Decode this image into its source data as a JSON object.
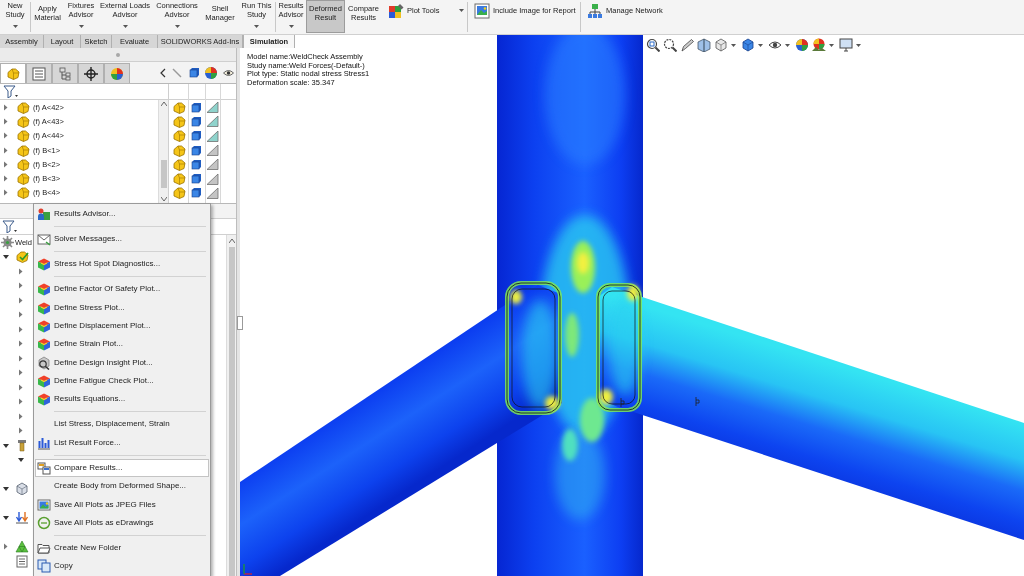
{
  "ribbon": {
    "buttons": [
      {
        "kind": "large",
        "lines": [
          "New",
          "Study"
        ],
        "dropdown": true,
        "pressed": false
      },
      {
        "kind": "large",
        "lines": [
          "Apply",
          "Material"
        ],
        "dropdown": false,
        "pressed": false
      },
      {
        "kind": "large",
        "lines": [
          "Fixtures",
          "Advisor"
        ],
        "dropdown": true,
        "pressed": false
      },
      {
        "kind": "large",
        "lines": [
          "External Loads",
          "Advisor"
        ],
        "dropdown": true,
        "pressed": false
      },
      {
        "kind": "large",
        "lines": [
          "Connections",
          "Advisor"
        ],
        "dropdown": true,
        "pressed": false
      },
      {
        "kind": "large",
        "lines": [
          "Shell",
          "Manager"
        ],
        "dropdown": false,
        "pressed": false
      },
      {
        "kind": "large",
        "lines": [
          "Run This",
          "Study"
        ],
        "dropdown": true,
        "pressed": false
      },
      {
        "kind": "large",
        "lines": [
          "Results",
          "Advisor"
        ],
        "dropdown": true,
        "pressed": false
      },
      {
        "kind": "large",
        "lines": [
          "Deformed",
          "Result"
        ],
        "dropdown": false,
        "pressed": true
      },
      {
        "kind": "large",
        "lines": [
          "Compare",
          "Results"
        ],
        "dropdown": false,
        "pressed": false
      },
      {
        "kind": "small",
        "label": "Plot Tools",
        "dropdown": true,
        "pressed": false
      },
      {
        "kind": "small",
        "label": "Include Image for Report",
        "dropdown": false,
        "pressed": false
      },
      {
        "kind": "small",
        "label": "Manage Network",
        "dropdown": false,
        "pressed": false
      }
    ]
  },
  "tabs": [
    {
      "label": "Assembly",
      "selected": false
    },
    {
      "label": "Layout",
      "selected": false
    },
    {
      "label": "Sketch",
      "selected": false
    },
    {
      "label": "Evaluate",
      "selected": false
    },
    {
      "label": "SOLIDWORKS Add-Ins",
      "selected": false
    },
    {
      "label": "Simulation",
      "selected": true
    }
  ],
  "feature_tree": {
    "panel_tabs": [
      {
        "selected": true
      },
      {
        "selected": false
      },
      {
        "selected": false
      },
      {
        "selected": false
      },
      {
        "selected": false
      }
    ],
    "items": [
      {
        "label": "(f) A<42>",
        "expanded": false,
        "color": "#8fd3cc"
      },
      {
        "label": "(f) A<43>",
        "expanded": false,
        "color": "#8fd3cc"
      },
      {
        "label": "(f) A<44>",
        "expanded": false,
        "color": "#8fd3cc"
      },
      {
        "label": "(f) B<1>",
        "expanded": false,
        "color": "#c4c4c4"
      },
      {
        "label": "(f) B<2>",
        "expanded": false,
        "color": "#c4c4c4"
      },
      {
        "label": "(f) B<3>",
        "expanded": false,
        "color": "#c4c4c4"
      },
      {
        "label": "(f) B<4>",
        "expanded": false,
        "color": "#c4c4c4"
      }
    ]
  },
  "study_tree": {
    "label": "Weld",
    "children": [
      {
        "kind": "parts",
        "expanded": true,
        "children": [
          {
            "expanded": false
          },
          {
            "expanded": false
          },
          {
            "expanded": false
          },
          {
            "expanded": false
          },
          {
            "expanded": false
          },
          {
            "expanded": false
          },
          {
            "expanded": false
          },
          {
            "expanded": false
          },
          {
            "expanded": false
          },
          {
            "expanded": false
          },
          {
            "expanded": false
          },
          {
            "expanded": false
          }
        ]
      },
      {
        "kind": "connections",
        "expanded": true,
        "children": [
          {
            "expanded": true
          }
        ]
      },
      {
        "kind": "fixtures",
        "expanded": true
      },
      {
        "kind": "loads",
        "expanded": true
      },
      {
        "kind": "mesh",
        "expanded": false
      },
      {
        "kind": "options"
      }
    ]
  },
  "context_menu": {
    "items": [
      {
        "kind": "item",
        "label": "Results Advisor...",
        "highlighted": false
      },
      {
        "kind": "separator"
      },
      {
        "kind": "item",
        "label": "Solver Messages...",
        "highlighted": false
      },
      {
        "kind": "separator"
      },
      {
        "kind": "item",
        "label": "Stress Hot Spot Diagnostics...",
        "highlighted": false
      },
      {
        "kind": "separator"
      },
      {
        "kind": "item",
        "label": "Define Factor Of Safety Plot...",
        "highlighted": false
      },
      {
        "kind": "item",
        "label": "Define Stress Plot...",
        "highlighted": false
      },
      {
        "kind": "item",
        "label": "Define Displacement Plot...",
        "highlighted": false
      },
      {
        "kind": "item",
        "label": "Define Strain Plot...",
        "highlighted": false
      },
      {
        "kind": "item",
        "label": "Define Design Insight Plot...",
        "highlighted": false
      },
      {
        "kind": "item",
        "label": "Define Fatigue Check Plot...",
        "highlighted": false
      },
      {
        "kind": "item",
        "label": "Results Equations...",
        "highlighted": false
      },
      {
        "kind": "separator"
      },
      {
        "kind": "item",
        "label": "List Stress, Displacement, Strain",
        "highlighted": false
      },
      {
        "kind": "item",
        "label": "List Result Force...",
        "highlighted": false
      },
      {
        "kind": "separator"
      },
      {
        "kind": "item",
        "label": "Compare Results...",
        "highlighted": true
      },
      {
        "kind": "item",
        "label": "Create Body from Deformed Shape...",
        "highlighted": false
      },
      {
        "kind": "item",
        "label": "Save All Plots as JPEG Files",
        "highlighted": false
      },
      {
        "kind": "item",
        "label": "Save All Plots as eDrawings",
        "highlighted": false
      },
      {
        "kind": "separator"
      },
      {
        "kind": "item",
        "label": "Create New Folder",
        "highlighted": false
      },
      {
        "kind": "item",
        "label": "Copy",
        "highlighted": false
      }
    ]
  },
  "viewport": {
    "plot_info": [
      "Model name:WeldCheck Assembly",
      "Study name:Weld Forces(-Default-)",
      "Plot type: Static nodal stress Stress1",
      "Deformation scale: 35.347"
    ]
  }
}
